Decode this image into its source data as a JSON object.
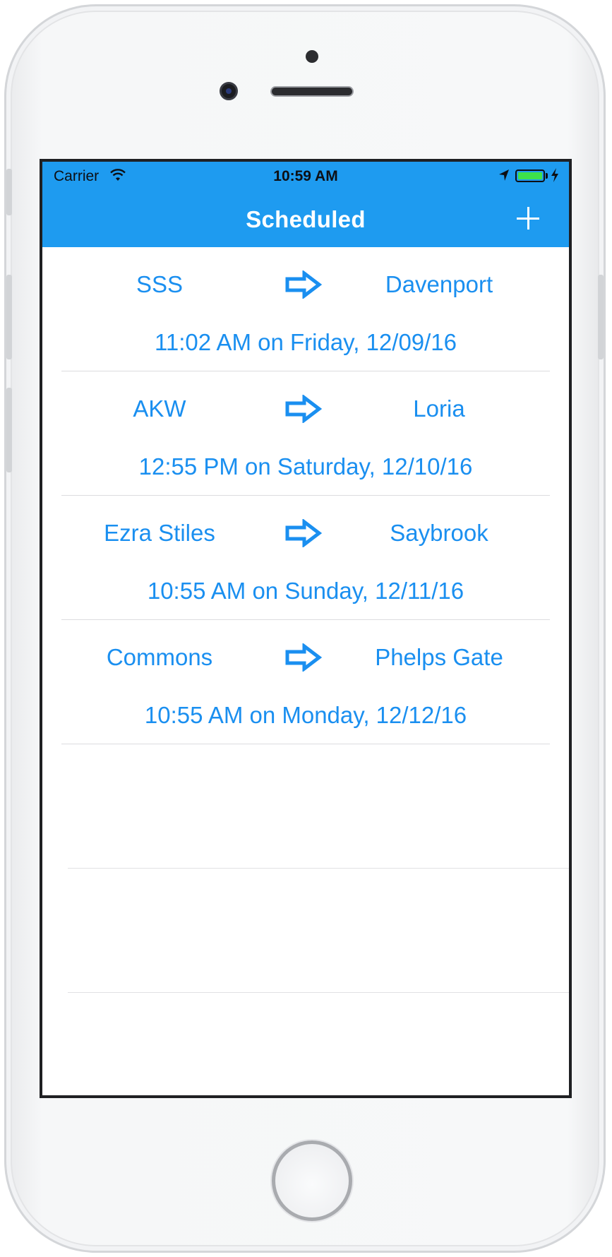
{
  "status": {
    "carrier": "Carrier",
    "time": "10:59 AM"
  },
  "nav": {
    "title": "Scheduled",
    "add_icon": "plus-icon"
  },
  "colors": {
    "accent": "#1e9bf0",
    "text_blue": "#1a8ff0",
    "battery": "#3de24b"
  },
  "rides": [
    {
      "from": "SSS",
      "to": "Davenport",
      "when": "11:02 AM on Friday, 12/09/16"
    },
    {
      "from": "AKW",
      "to": "Loria",
      "when": "12:55 PM on Saturday, 12/10/16"
    },
    {
      "from": "Ezra Stiles",
      "to": "Saybrook",
      "when": "10:55 AM on Sunday, 12/11/16"
    },
    {
      "from": "Commons",
      "to": "Phelps Gate",
      "when": "10:55 AM on Monday, 12/12/16"
    }
  ]
}
